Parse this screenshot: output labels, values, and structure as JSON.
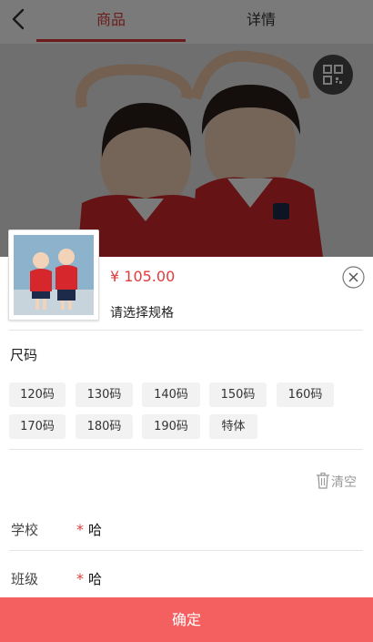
{
  "nav": {
    "tabs": [
      {
        "label": "商品"
      },
      {
        "label": "详情"
      }
    ]
  },
  "sheet": {
    "price": "¥ 105.00",
    "hint": "请选择规格",
    "spec_title": "尺码",
    "sizes": [
      "120码",
      "130码",
      "140码",
      "150码",
      "160码",
      "170码",
      "180码",
      "190码",
      "特体"
    ],
    "clear_label": "清空",
    "fields": [
      {
        "label": "学校",
        "value": "哈"
      },
      {
        "label": "班级",
        "value": "哈"
      }
    ],
    "confirm_label": "确定"
  },
  "colors": {
    "accent": "#e23b3b",
    "confirm_bg": "#f45f5f"
  }
}
